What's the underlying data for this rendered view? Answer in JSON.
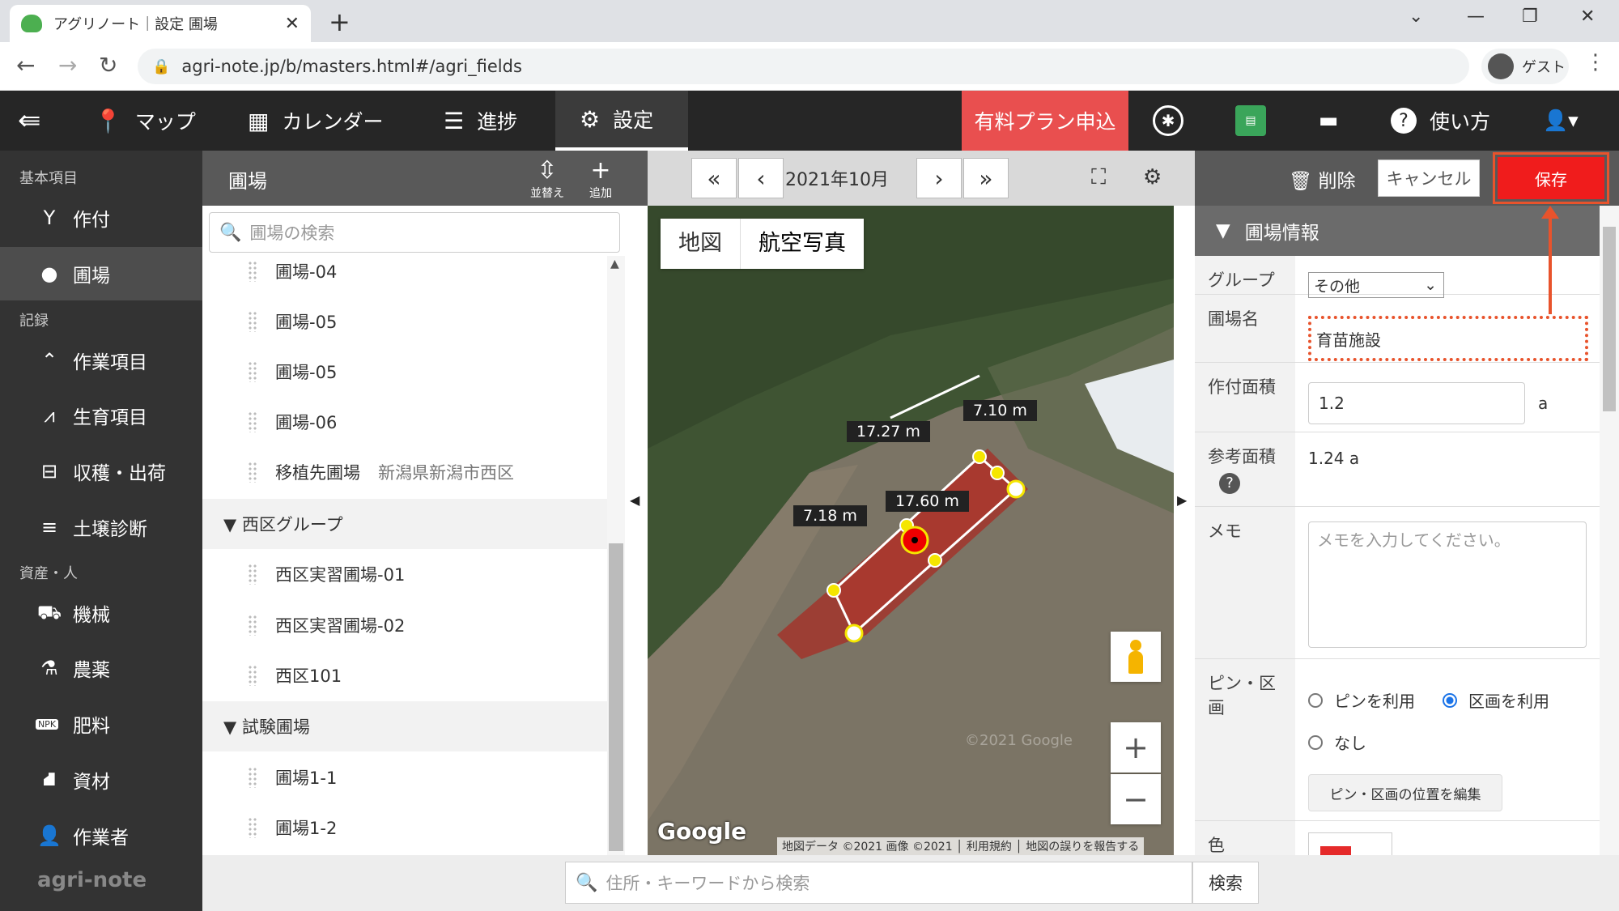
{
  "browser": {
    "tab_title": "アグリノート｜設定 圃場",
    "tab_close": "✕",
    "new_tab": "+",
    "url": "agri-note.jp/b/masters.html#/agri_fields",
    "profile": "ゲスト"
  },
  "nav": {
    "map": "マップ",
    "calendar": "カレンダー",
    "progress": "進捗",
    "settings": "設定",
    "paid_plan": "有料プラン申込",
    "help": "使い方"
  },
  "sidebar": {
    "sec_basic": "基本項目",
    "crops": "作付",
    "fields": "圃場",
    "sec_records": "記録",
    "work_items": "作業項目",
    "growth_items": "生育項目",
    "harvest": "収穫・出荷",
    "soil": "土壌診断",
    "sec_assets": "資産・人",
    "machines": "機械",
    "pesticides": "農薬",
    "fertilizer": "肥料",
    "materials": "資材",
    "workers": "作業者",
    "logo": "agri-note"
  },
  "list": {
    "title": "圃場",
    "sort_label": "並替え",
    "add_label": "追加",
    "search_placeholder": "圃場の検索",
    "rows": [
      {
        "name": "圃場-04"
      },
      {
        "name": "圃場-05"
      },
      {
        "name": "圃場-05"
      },
      {
        "name": "圃場-06"
      },
      {
        "name": "移植先圃場",
        "sub": "新潟県新潟市西区"
      }
    ],
    "group1": "▼ 西区グループ",
    "group1_rows": [
      {
        "name": "西区実習圃場-01"
      },
      {
        "name": "西区実習圃場-02"
      },
      {
        "name": "西区101"
      }
    ],
    "group2": "▼ 試験圃場",
    "group2_rows": [
      {
        "name": "圃場1-1"
      },
      {
        "name": "圃場1-2"
      }
    ]
  },
  "map": {
    "month": "2021年10月",
    "type_map": "地図",
    "type_aerial": "航空写真",
    "measurements": [
      "17.27 m",
      "7.10 m",
      "17.60 m",
      "7.18 m"
    ],
    "google": "Google",
    "attribution": "地図データ ©2021 画像 ©2021 │ 利用規約 │ 地図の誤りを報告する",
    "watermark": "©2021 Google",
    "zoom_in": "+",
    "zoom_out": "−"
  },
  "edit": {
    "delete": "削除",
    "cancel": "キャンセル",
    "save": "保存",
    "section": "圃場情報",
    "group_label": "グループ",
    "group_value": "その他",
    "name_label": "圃場名",
    "name_value": "育苗施設",
    "area_label": "作付面積",
    "area_value": "1.2",
    "area_unit": "a",
    "ref_area_label": "参考面積",
    "ref_area_value": "1.24 a",
    "memo_label": "メモ",
    "memo_placeholder": "メモを入力してください。",
    "pin_label": "ピン・区画",
    "opt_pin": "ピンを利用",
    "opt_area": "区画を利用",
    "opt_none": "なし",
    "pin_edit_button": "ピン・区画の位置を編集",
    "color_label": "色",
    "color_value": "#e52a2a"
  },
  "bottom": {
    "search_placeholder": "住所・キーワードから検索",
    "search_button": "検索"
  }
}
